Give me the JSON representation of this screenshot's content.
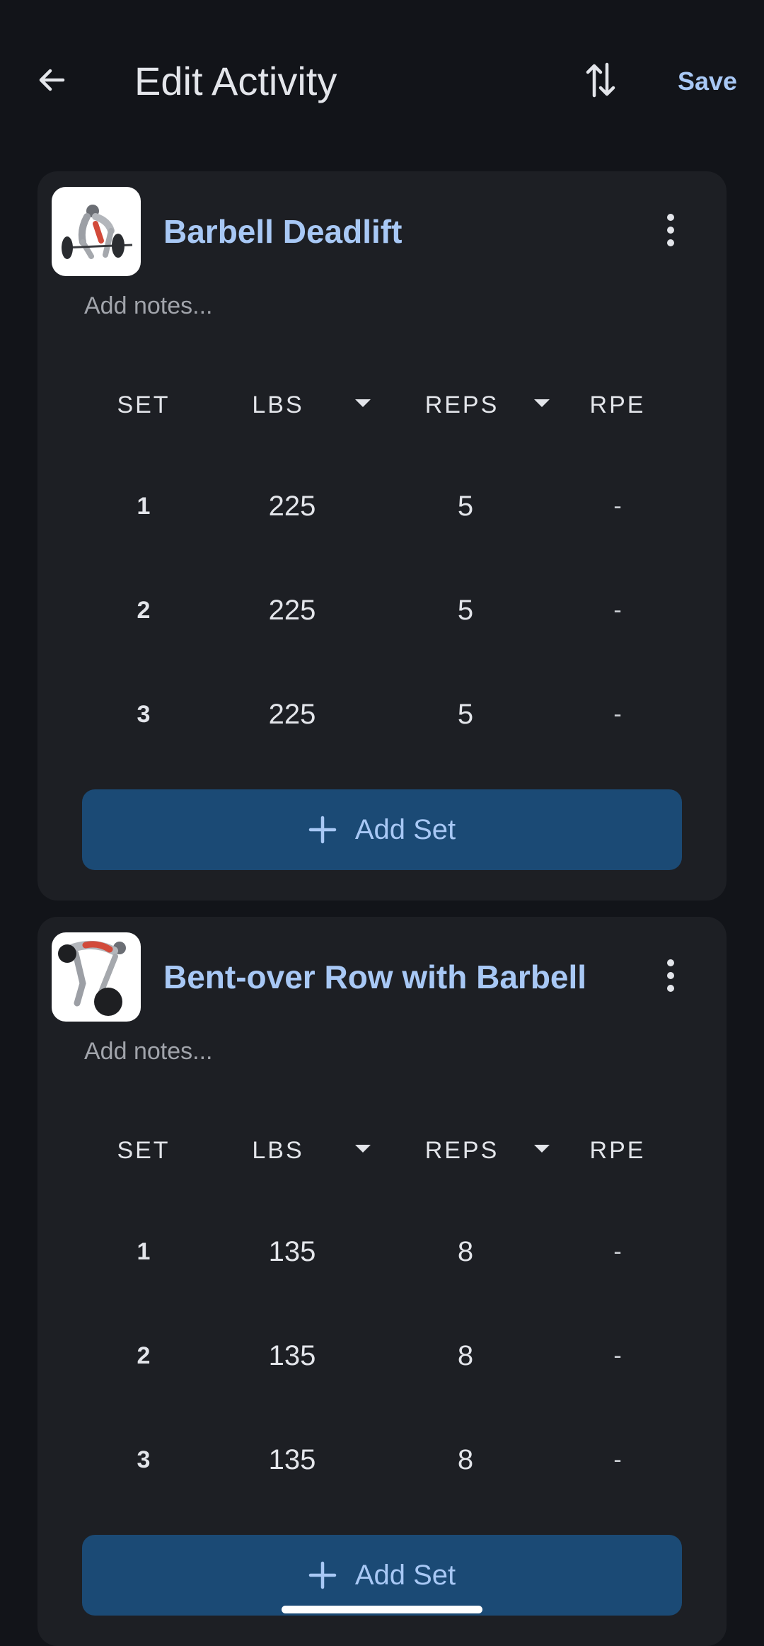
{
  "header": {
    "back_icon": "arrow-back-icon",
    "title": "Edit Activity",
    "sort_icon": "swap-vert-icon",
    "save_label": "Save"
  },
  "colors": {
    "background": "#121419",
    "card": "#1d1f24",
    "accent": "#a8c8f5",
    "button": "#1b4a75"
  },
  "exercises": [
    {
      "name": "Barbell Deadlift",
      "notes_placeholder": "Add notes...",
      "columns": {
        "set": "SET",
        "weight": "LBS",
        "reps": "REPS",
        "rpe": "RPE"
      },
      "sets": [
        {
          "set": "1",
          "weight": "225",
          "reps": "5",
          "rpe": "-"
        },
        {
          "set": "2",
          "weight": "225",
          "reps": "5",
          "rpe": "-"
        },
        {
          "set": "3",
          "weight": "225",
          "reps": "5",
          "rpe": "-"
        }
      ],
      "add_set_label": "Add Set"
    },
    {
      "name": "Bent-over Row with Barbell",
      "notes_placeholder": "Add notes...",
      "columns": {
        "set": "SET",
        "weight": "LBS",
        "reps": "REPS",
        "rpe": "RPE"
      },
      "sets": [
        {
          "set": "1",
          "weight": "135",
          "reps": "8",
          "rpe": "-"
        },
        {
          "set": "2",
          "weight": "135",
          "reps": "8",
          "rpe": "-"
        },
        {
          "set": "3",
          "weight": "135",
          "reps": "8",
          "rpe": "-"
        }
      ],
      "add_set_label": "Add Set"
    }
  ]
}
